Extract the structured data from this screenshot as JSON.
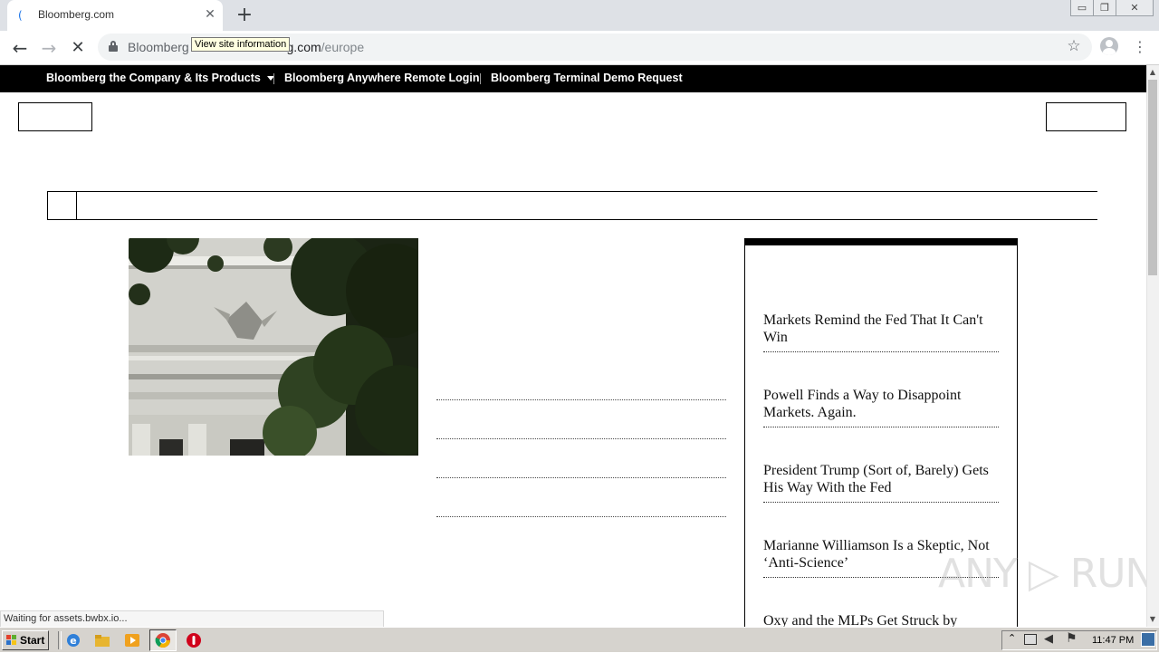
{
  "browser": {
    "tab_title": "Bloomberg.com",
    "tab_favicon": "(",
    "close_tab_glyph": "✕",
    "new_tab_glyph": "+",
    "back_glyph": "←",
    "forward_glyph": "→",
    "stop_glyph": "✕",
    "url_site": "Bloomberg",
    "url_domain": "www.bloomberg.com",
    "url_path": "/europe",
    "tooltip": "View site information",
    "star_glyph": "☆",
    "menu_glyph": "⋮",
    "window_controls": {
      "minimize": "▭",
      "restore": "❐",
      "close": "✕"
    }
  },
  "nav": {
    "items": [
      "Bloomberg the Company & Its Products",
      "Bloomberg Anywhere Remote Login",
      "Bloomberg Terminal Demo Request"
    ]
  },
  "opinion": {
    "headlines": [
      "Markets Remind the Fed That It Can't Win",
      "Powell Finds a Way to Disappoint Markets. Again.",
      "President Trump (Sort of, Barely) Gets His Way With the Fed",
      "Marianne Williamson Is a Skeptic, Not ‘Anti-Science’",
      "Oxy and the MLPs Get Struck by Lightning"
    ]
  },
  "status": "Waiting for assets.bwbx.io...",
  "watermark": "ANY ▷ RUN",
  "taskbar": {
    "start_label": "Start",
    "clock": "11:47 PM"
  },
  "colors": {
    "nav_bg": "#000000",
    "tab_strip": "#dee1e6",
    "taskbar": "#d6d3ce"
  }
}
